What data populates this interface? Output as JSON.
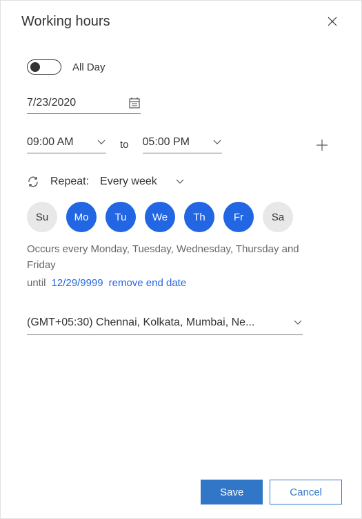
{
  "title": "Working hours",
  "all_day_label": "All Day",
  "date_value": "7/23/2020",
  "start_time": "09:00 AM",
  "to_label": "to",
  "end_time": "05:00 PM",
  "repeat_label": "Repeat:",
  "repeat_value": "Every week",
  "days": [
    {
      "abbr": "Su",
      "selected": false
    },
    {
      "abbr": "Mo",
      "selected": true
    },
    {
      "abbr": "Tu",
      "selected": true
    },
    {
      "abbr": "We",
      "selected": true
    },
    {
      "abbr": "Th",
      "selected": true
    },
    {
      "abbr": "Fr",
      "selected": true
    },
    {
      "abbr": "Sa",
      "selected": false
    }
  ],
  "occurs_text": "Occurs every Monday, Tuesday, Wednesday, Thursday and Friday",
  "until_label": "until",
  "until_date": "12/29/9999",
  "remove_end_label": "remove end date",
  "timezone": "(GMT+05:30) Chennai, Kolkata, Mumbai, Ne...",
  "save_label": "Save",
  "cancel_label": "Cancel"
}
